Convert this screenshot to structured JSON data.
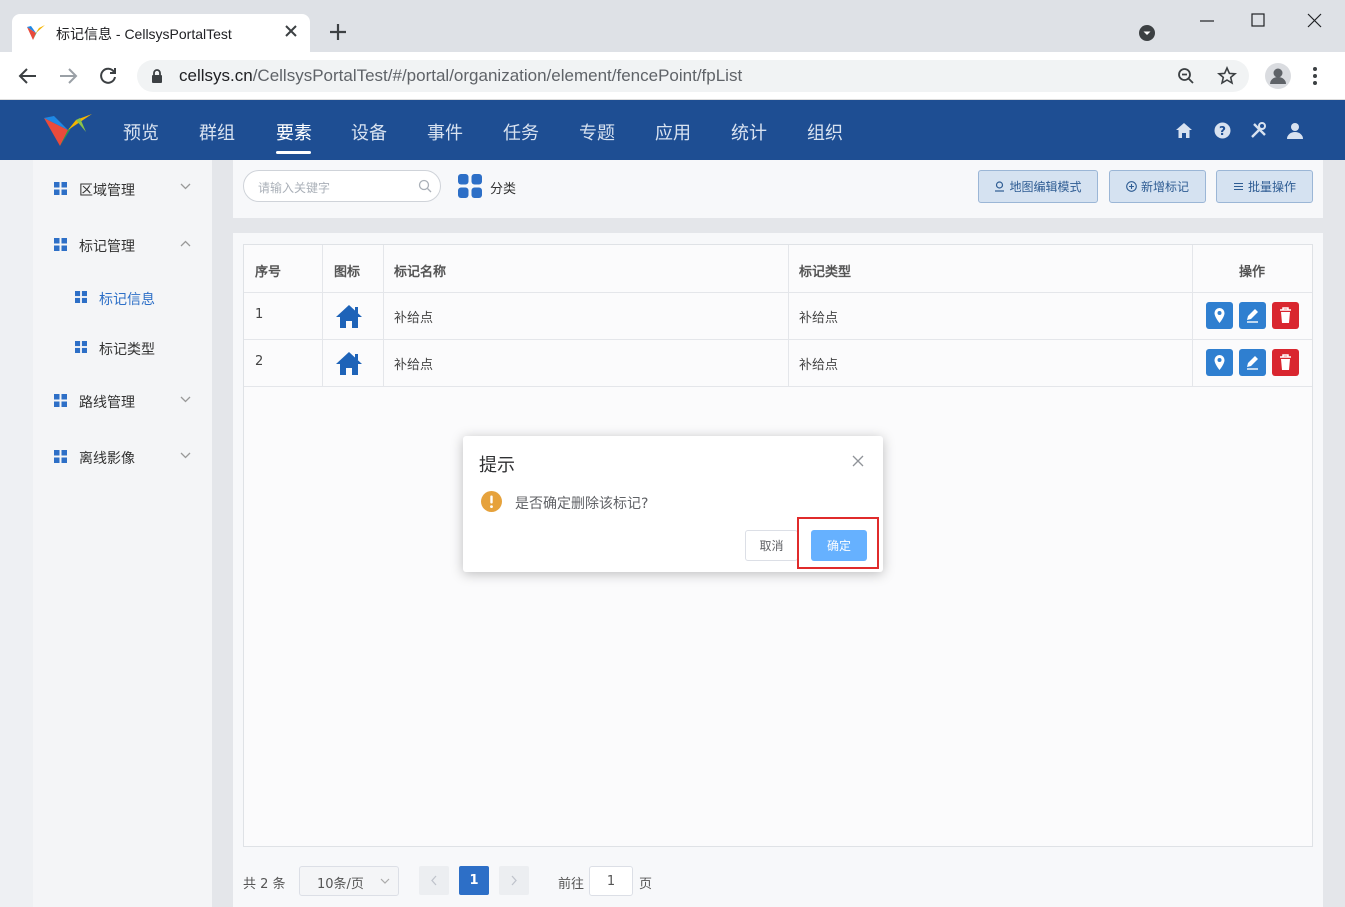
{
  "browser": {
    "tab_title": "标记信息 - CellsysPortalTest",
    "url_host": "cellsys.cn",
    "url_path": "/CellsysPortalTest/#/portal/organization/element/fencePoint/fpList"
  },
  "header": {
    "nav": [
      "预览",
      "群组",
      "要素",
      "设备",
      "事件",
      "任务",
      "专题",
      "应用",
      "统计",
      "组织"
    ],
    "active_nav": "要素",
    "bg_color": "#1e4e93",
    "icons": [
      "home-icon",
      "help-icon",
      "tools-icon",
      "user-icon"
    ]
  },
  "sidebar": {
    "items": [
      {
        "label": "区域管理",
        "expanded": false
      },
      {
        "label": "标记管理",
        "expanded": true
      },
      {
        "label": "标记信息",
        "sub": true,
        "active": true
      },
      {
        "label": "标记类型",
        "sub": true
      },
      {
        "label": "路线管理",
        "expanded": false
      },
      {
        "label": "离线影像",
        "expanded": false
      }
    ]
  },
  "toolbar": {
    "search_placeholder": "请输入关键字",
    "category_label": "分类",
    "map_edit_label": "地图编辑模式",
    "add_label": "新增标记",
    "batch_label": "批量操作"
  },
  "table": {
    "columns": [
      "序号",
      "图标",
      "标记名称",
      "标记类型",
      "操作"
    ],
    "rows": [
      {
        "index": "1",
        "icon": "house-icon",
        "name": "补给点",
        "type": "补给点"
      },
      {
        "index": "2",
        "icon": "house-icon",
        "name": "补给点",
        "type": "补给点"
      }
    ]
  },
  "pagination": {
    "total": "共 2 条",
    "page_size": "10条/页",
    "current_page": "1",
    "goto_prefix": "前往",
    "goto_value": "1",
    "goto_suffix": "页"
  },
  "dialog": {
    "title": "提示",
    "message": "是否确定删除该标记?",
    "cancel_label": "取消",
    "ok_label": "确定",
    "ok_color": "#66b1ff",
    "highlight_color": "#e02b2b"
  }
}
